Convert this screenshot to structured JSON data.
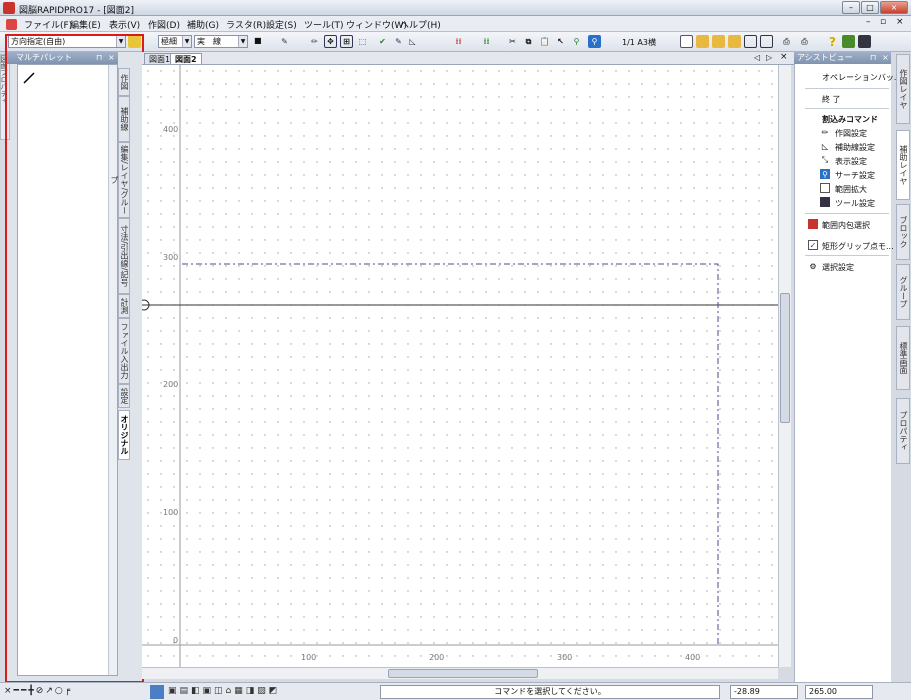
{
  "window": {
    "title": "図脳RAPIDPRO17 - [図面2]",
    "min": "–",
    "max": "□",
    "close": "×",
    "doc_min": "–",
    "doc_restore": "▫",
    "doc_close": "×"
  },
  "menu": [
    "ファイル(F)",
    "編集(E)",
    "表示(V)",
    "作図(D)",
    "補助(G)",
    "ラスタ(R)",
    "設定(S)",
    "ツール(T)",
    "ウィンドウ(W)",
    "ヘルプ(H)"
  ],
  "toolbar": {
    "direction_combo": "方向指定(自由)",
    "line_width_combo": "極細",
    "line_type_combo": "実　線",
    "color_combo": "■",
    "page_label": "1/1 A3横"
  },
  "left_panel": {
    "title": "マルチパレット",
    "pin": "⊓",
    "close": "×",
    "tabs": [
      "作図",
      "補助線",
      "編集/レイヤ/グループ",
      "寸法/引出線/記号",
      "計測",
      "ファイル入出力",
      "設定",
      "オリジナル"
    ],
    "outer_tab": "図面プロパティ"
  },
  "doc_tabs": [
    "図面1",
    "図面2"
  ],
  "canvas": {
    "y_labels": [
      "400",
      "300",
      "200",
      "100",
      "0"
    ],
    "x_labels": [
      "100",
      "200",
      "300",
      "400"
    ]
  },
  "assist": {
    "title": "アシストビュー",
    "pin": "⊓",
    "close": "×",
    "operation": "オペレーションバッ...",
    "end": "終 了",
    "interrupt_title": "割込みコマンド",
    "commands": [
      "作図設定",
      "補助線設定",
      "表示設定",
      "サーチ設定",
      "範囲拡大",
      "ツール設定"
    ],
    "options": [
      "範囲内包選択",
      "矩形グリップ点モ..."
    ],
    "select_settings": "選択設定"
  },
  "right_tabs": [
    "作図レイヤ",
    "補助レイヤ",
    "ブロック",
    "グループ",
    "標準画面",
    "プロパティ"
  ],
  "status": {
    "message": "コマンドを選択してください。",
    "x": "-28.89",
    "y": "265.00"
  },
  "colors": {
    "accent": "#d81c1c",
    "panel_header": "#8598b4",
    "dashed_rect": "#4a4a8a"
  }
}
